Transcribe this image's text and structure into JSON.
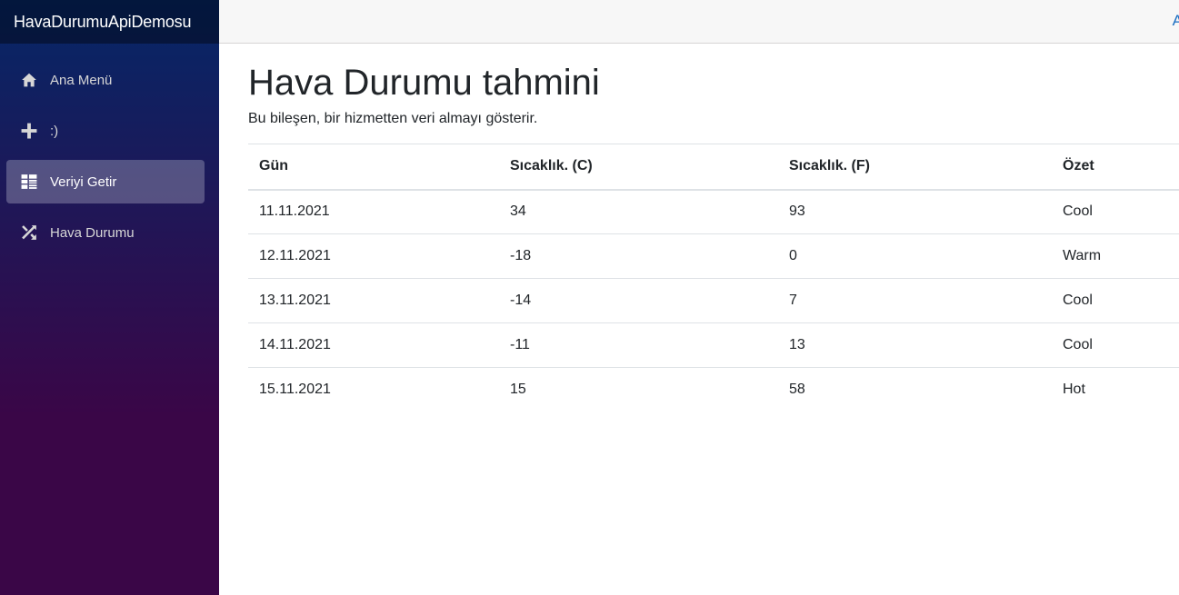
{
  "app": {
    "brand": "HavaDurumuApiDemosu"
  },
  "sidebar": {
    "items": [
      {
        "label": "Ana Menü",
        "icon": "home-icon",
        "active": false
      },
      {
        "label": ":)",
        "icon": "plus-icon",
        "active": false
      },
      {
        "label": "Veriyi Getir",
        "icon": "list-icon",
        "active": true
      },
      {
        "label": "Hava Durumu",
        "icon": "shuffle-icon",
        "active": false
      }
    ]
  },
  "top_row": {
    "link_label": "A"
  },
  "page": {
    "title": "Hava Durumu tahmini",
    "subtitle": "Bu bileşen, bir hizmetten veri almayı gösterir."
  },
  "table": {
    "headers": [
      "Gün",
      "Sıcaklık. (C)",
      "Sıcaklık. (F)",
      "Özet"
    ],
    "rows": [
      [
        "11.11.2021",
        "34",
        "93",
        "Cool"
      ],
      [
        "12.11.2021",
        "-18",
        "0",
        "Warm"
      ],
      [
        "13.11.2021",
        "-14",
        "7",
        "Cool"
      ],
      [
        "14.11.2021",
        "-11",
        "13",
        "Cool"
      ],
      [
        "15.11.2021",
        "15",
        "58",
        "Hot"
      ]
    ]
  },
  "colors": {
    "link": "#1b6ec2",
    "sidebar_top": "#052767",
    "sidebar_bottom": "#3a0647"
  }
}
